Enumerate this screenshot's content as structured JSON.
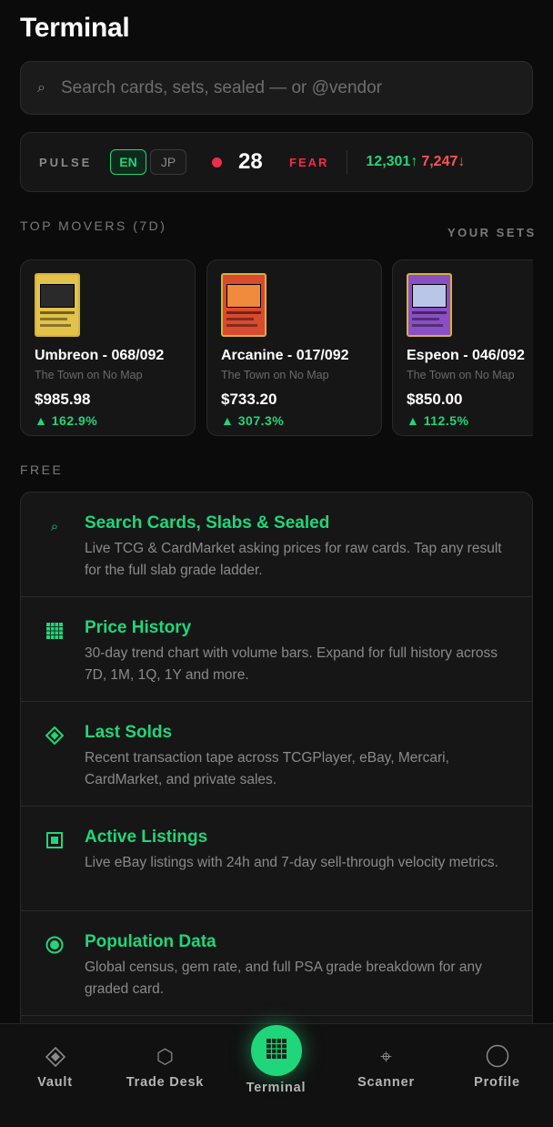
{
  "header": {
    "title": "Terminal"
  },
  "search": {
    "placeholder": "Search cards, sets, sealed — or @vendor"
  },
  "pulse": {
    "label": "PULSE",
    "languages": [
      "EN",
      "JP"
    ],
    "selected_language": "EN",
    "fear_greed_value": "28",
    "fear_greed_label": "FEAR",
    "advancers": "12,301↑",
    "decliners": "7,247↓",
    "colors": {
      "up": "#1fd67a",
      "down": "#ff5252",
      "fear": "#ef2d4a"
    }
  },
  "sections": {
    "movers_title": "TOP MOVERS (7D)",
    "your_sets": "YOUR SETS",
    "free_title": "FREE"
  },
  "movers": [
    {
      "name": "Umbreon - 068/092",
      "set": "The Town on No Map",
      "price": "$985.98",
      "change": "▲ 162.9%"
    },
    {
      "name": "Arcanine - 017/092",
      "set": "The Town on No Map",
      "price": "$733.20",
      "change": "▲ 307.3%"
    },
    {
      "name": "Espeon - 046/092",
      "set": "The Town on No Map",
      "price": "$850.00",
      "change": "▲ 112.5%"
    }
  ],
  "features": [
    {
      "icon": "search-icon",
      "title": "Search Cards, Slabs & Sealed",
      "desc": "Live TCG & CardMarket asking prices for raw cards. Tap any result for the full slab grade ladder."
    },
    {
      "icon": "chart-grid-icon",
      "title": "Price History",
      "desc": "30-day trend chart with volume bars. Expand for full history across 7D, 1M, 1Q, 1Y and more."
    },
    {
      "icon": "diamond-icon",
      "title": "Last Solds",
      "desc": "Recent transaction tape across TCGPlayer, eBay, Mercari, CardMarket, and private sales."
    },
    {
      "icon": "square-icon",
      "title": "Active Listings",
      "desc": "Live eBay listings with 24h and 7-day sell-through velocity metrics."
    },
    {
      "icon": "target-circle-icon",
      "title": "Population Data",
      "desc": "Global census, gem rate, and full PSA grade breakdown for any graded card."
    }
  ],
  "tabs": [
    {
      "label": "Vault",
      "icon": "diamond-icon"
    },
    {
      "label": "Trade Desk",
      "icon": "hexagon-icon"
    },
    {
      "label": "Terminal",
      "icon": "grid-icon",
      "active": true
    },
    {
      "label": "Scanner",
      "icon": "crosshair-icon"
    },
    {
      "label": "Profile",
      "icon": "circle-icon"
    }
  ]
}
